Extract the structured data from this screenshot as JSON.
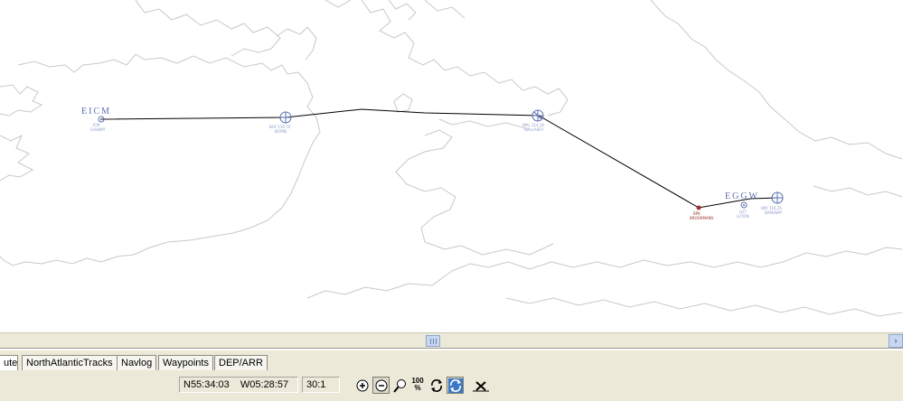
{
  "map": {
    "route": {
      "origin": "EICM",
      "destination": "EGGW",
      "waypoints": [
        {
          "name": "EICM",
          "kind": "airport"
        },
        {
          "name": "BOYNE",
          "kind": "vor"
        },
        {
          "name": "WALLASEY",
          "kind": "vor"
        },
        {
          "name": "BPK",
          "kind": "fix"
        },
        {
          "name": "EGGW",
          "kind": "airport"
        }
      ]
    },
    "labels": {
      "origin_code": "EICM",
      "destination_code": "EGGW",
      "origin_sub": "ICM",
      "origin_sub2": "GALWAY",
      "vor1_sub": "BOY 116.70",
      "vor1_sub2": "BOYNE",
      "vor2_sub": "WAL 114.10",
      "vor2_sub2": "WALLASEY",
      "fix_sub": "BPK",
      "fix_sub2": "BROOKMANS",
      "dest_sub": "LUT",
      "dest_sub2": "LUTON",
      "vor3_sub": "BKY 116.25",
      "vor3_sub2": "BARKWAY"
    },
    "colors": {
      "coastline": "#c8c8c8",
      "route_line": "#000000",
      "symbol": "#5a6fb0",
      "fix": "#a03030"
    }
  },
  "scrollbar": {
    "right_arrow": "›"
  },
  "tabs": [
    {
      "label": "ute",
      "active": true
    },
    {
      "label": "NorthAtlanticTracks",
      "active": false
    },
    {
      "label": "Navlog",
      "active": false
    },
    {
      "label": "Waypoints",
      "active": false
    },
    {
      "label": "DEP/ARR",
      "active": false
    }
  ],
  "status": {
    "latitude": "N55:34:03",
    "longitude": "W05:28:57",
    "zoom": "30:1"
  },
  "toolbar": {
    "buttons": [
      {
        "icon": "zoom-in-icon"
      },
      {
        "icon": "zoom-out-icon"
      },
      {
        "icon": "zoom-area-icon"
      },
      {
        "icon": "zoom-100-icon",
        "text": "100"
      },
      {
        "icon": "refresh-icon"
      },
      {
        "icon": "sync-icon",
        "pressed": true
      },
      {
        "icon": "close-icon"
      }
    ],
    "zoom100_label": "100",
    "zoom100_sub": "%"
  }
}
